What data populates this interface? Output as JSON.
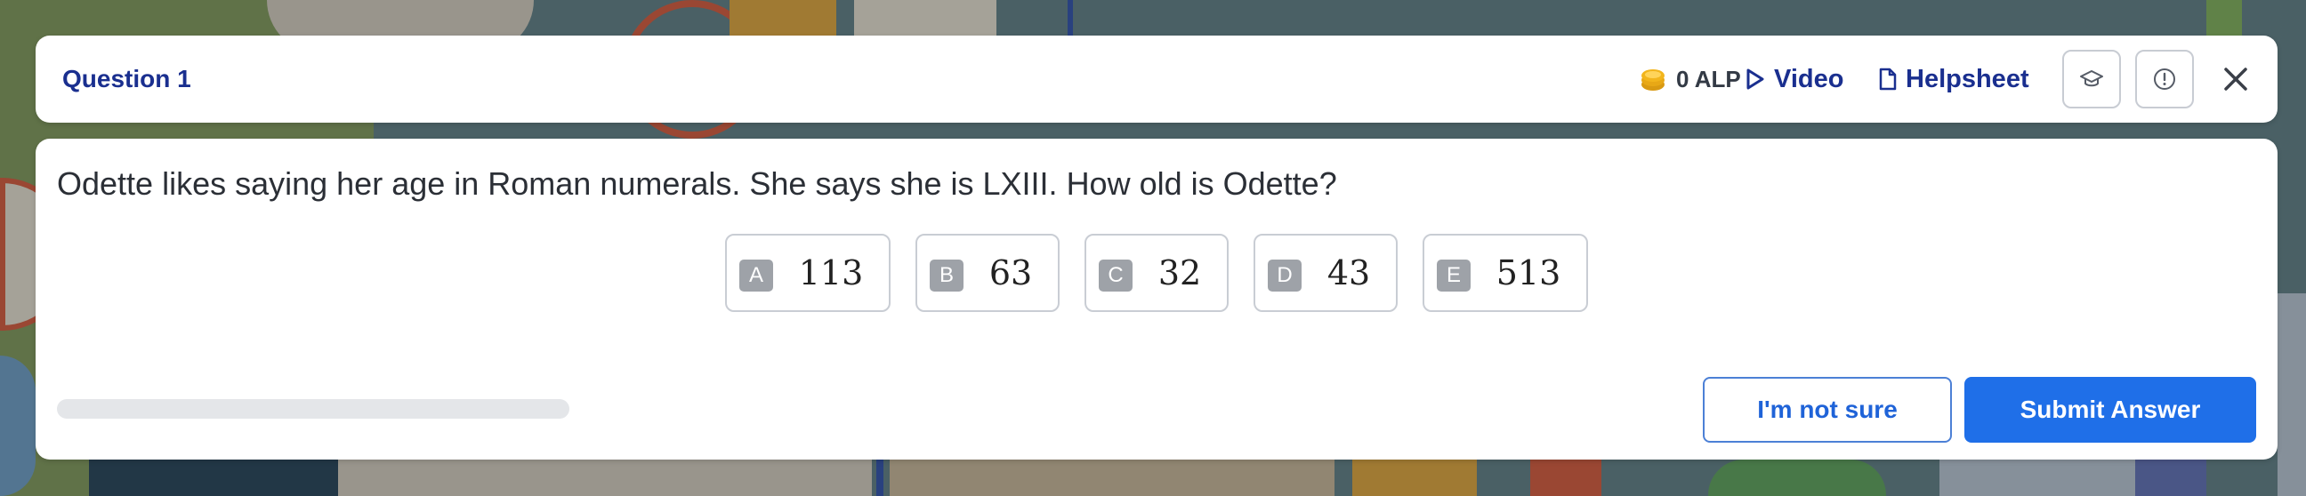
{
  "header": {
    "title": "Question 1",
    "alp": "0 ALP",
    "video_label": "Video",
    "helpsheet_label": "Helpsheet"
  },
  "question": {
    "text": "Odette likes saying her age in Roman numerals. She says she is LXIII. How old is Odette?",
    "options": [
      {
        "letter": "A",
        "value": "113"
      },
      {
        "letter": "B",
        "value": "63"
      },
      {
        "letter": "C",
        "value": "32"
      },
      {
        "letter": "D",
        "value": "43"
      },
      {
        "letter": "E",
        "value": "513"
      }
    ]
  },
  "progress": {
    "fraction": 0
  },
  "footer": {
    "not_sure_label": "I'm not sure",
    "submit_label": "Submit Answer"
  },
  "colors": {
    "title_blue": "#1a2f8f",
    "submit_blue": "#1f6fe8",
    "coin_gold": "#f2b51c"
  },
  "icons": {
    "coin": "coin-icon",
    "video": "play-icon",
    "helpsheet": "document-icon",
    "grad": "graduation-cap-icon",
    "report": "alert-circle-icon",
    "close": "close-icon"
  }
}
